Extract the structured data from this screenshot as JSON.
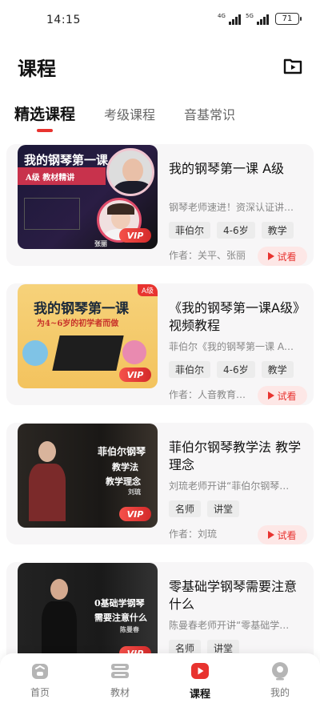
{
  "status_bar": {
    "time": "14:15",
    "net1": "4G",
    "net2": "5G",
    "battery": "71"
  },
  "header": {
    "title": "课程"
  },
  "tabs": [
    {
      "label": "精选课程",
      "active": true
    },
    {
      "label": "考级课程",
      "active": false
    },
    {
      "label": "音基常识",
      "active": false
    }
  ],
  "courses": [
    {
      "title": "我的钢琴第一课 A级",
      "desc": "钢琴老师速进！资深认证讲…",
      "tags": [
        "菲伯尔",
        "4-6岁",
        "教学"
      ],
      "author": "作者：关平、张丽",
      "try": "试看",
      "thumb_text": "我的钢琴第一课",
      "thumb_sub": "A级 教材精讲",
      "thumb_name": "张丽",
      "vip": "VIP"
    },
    {
      "title": "《我的钢琴第一课A级》视频教程",
      "desc": "菲伯尔《我的钢琴第一课 A…",
      "tags": [
        "菲伯尔",
        "4-6岁",
        "教学"
      ],
      "author": "作者：人音教育…",
      "try": "试看",
      "thumb_text": "我的钢琴第一课",
      "thumb_sub": "为4~6岁的初学者而做",
      "thumb_badge": "A级",
      "vip": "VIP"
    },
    {
      "title": "菲伯尔钢琴教学法 教学理念",
      "desc": "刘琉老师开讲“菲伯尔钢琴…",
      "tags": [
        "名师",
        "讲堂"
      ],
      "author": "作者：刘琉",
      "try": "试看",
      "thumb_text": "菲伯尔钢琴",
      "thumb_sub": "教学法",
      "thumb_sub2": "教学理念",
      "thumb_name": "刘琉",
      "vip": "VIP"
    },
    {
      "title": "零基础学钢琴需要注意什么",
      "desc": "陈曼春老师开讲“零基础学…",
      "tags": [
        "名师",
        "讲堂"
      ],
      "author": "",
      "try": "",
      "thumb_text": "0基础学钢琴",
      "thumb_sub": "需要注意什么",
      "thumb_name": "陈曼春",
      "vip": "VIP"
    }
  ],
  "bottom_nav": [
    {
      "label": "首页",
      "icon": "home-icon",
      "active": false
    },
    {
      "label": "教材",
      "icon": "books-icon",
      "active": false
    },
    {
      "label": "课程",
      "icon": "course-play-icon",
      "active": true
    },
    {
      "label": "我的",
      "icon": "profile-icon",
      "active": false
    }
  ],
  "colors": {
    "accent": "#e8332f",
    "tag_bg": "#ececec",
    "card_bg": "#f7f6f7"
  }
}
